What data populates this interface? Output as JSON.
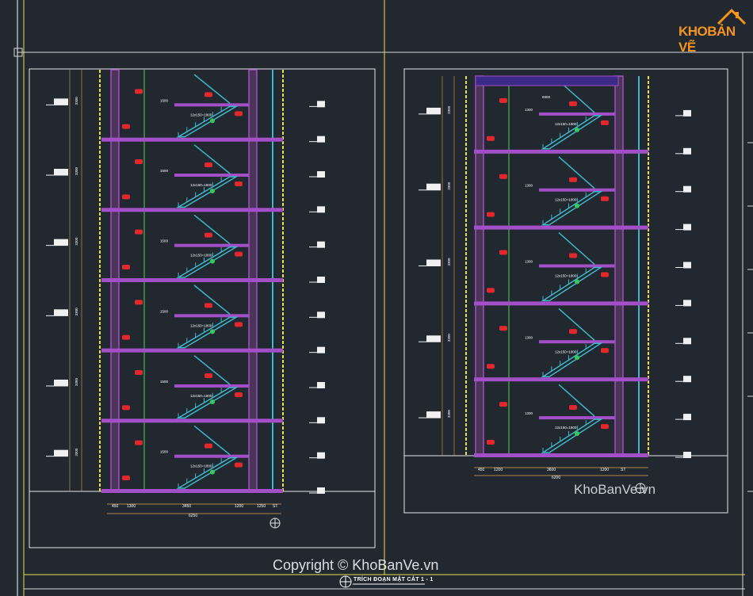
{
  "brand": {
    "prefix": "KHO",
    "suffix": "BẢN VẼ",
    "color": "#f7941d"
  },
  "watermark": "KhoBanVe.vn",
  "copyright": "Copyright © KhoBanVe.vn",
  "caption": "TRÍCH ĐOẠN MẶT CẮT 1 - 1",
  "colors": {
    "background": "#212830",
    "frame": "#e6e6e6",
    "border_yellow": "#e9e14a",
    "wall_purple": "#a34fc8",
    "stair_cyan": "#3fb6c8",
    "marker_red": "#e0282d",
    "dim_line": "#e2a34a"
  },
  "left_section": {
    "dims_bottom": [
      "450",
      "1300",
      "3450",
      "1200",
      "1250",
      "ST"
    ],
    "dim_total": "6250",
    "floor_heights": [
      "3300",
      "3300",
      "3300",
      "3300",
      "3300",
      "3300"
    ],
    "stair_label": "1500",
    "step_label": "12x150=1800"
  },
  "right_section": {
    "dims_bottom": [
      "450",
      "1200",
      "3600",
      "1200",
      "ST"
    ],
    "dim_total": "6200",
    "floor_heights": [
      "3300",
      "3300",
      "3300",
      "3300",
      "3300"
    ],
    "top_label": "6900",
    "stair_label": "1300",
    "step_label": "12x150=1800"
  }
}
